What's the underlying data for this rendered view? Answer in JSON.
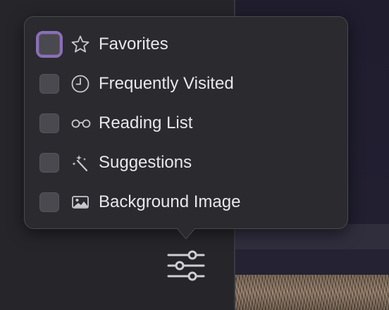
{
  "popover": {
    "items": [
      {
        "label": "Favorites",
        "icon": "star-icon",
        "checked": false
      },
      {
        "label": "Frequently Visited",
        "icon": "clock-icon",
        "checked": false
      },
      {
        "label": "Reading List",
        "icon": "glasses-icon",
        "checked": false
      },
      {
        "label": "Suggestions",
        "icon": "magic-wand-icon",
        "checked": false
      },
      {
        "label": "Background Image",
        "icon": "photo-icon",
        "checked": false
      }
    ]
  },
  "toolbar": {
    "settings_icon": "sliders-icon"
  },
  "colors": {
    "popover_bg": "#2b2a2f",
    "focus_ring": "#8a6fb8",
    "text": "#e8e7ec",
    "checkbox": "#4a494f"
  }
}
